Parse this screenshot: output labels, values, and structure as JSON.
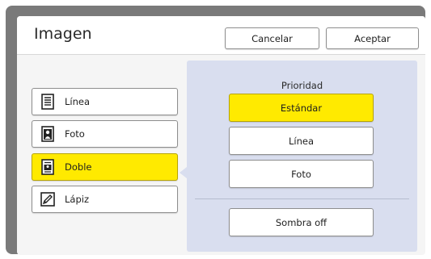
{
  "dialog": {
    "title": "Imagen",
    "cancel_label": "Cancelar",
    "accept_label": "Aceptar"
  },
  "modes": [
    {
      "label": "Línea",
      "icon": "document-lines-icon",
      "selected": false
    },
    {
      "label": "Foto",
      "icon": "portrait-photo-icon",
      "selected": false
    },
    {
      "label": "Doble",
      "icon": "document-lines-photo-icon",
      "selected": true
    },
    {
      "label": "Lápiz",
      "icon": "pencil-icon",
      "selected": false
    }
  ],
  "priority": {
    "label": "Prioridad",
    "options": [
      {
        "label": "Estándar",
        "selected": true
      },
      {
        "label": "Línea",
        "selected": false
      },
      {
        "label": "Foto",
        "selected": false
      }
    ],
    "shadow_label": "Sombra off"
  },
  "colors": {
    "selected": "#ffea00",
    "frame": "#7a7a7a",
    "options_panel": "#d9deef"
  }
}
